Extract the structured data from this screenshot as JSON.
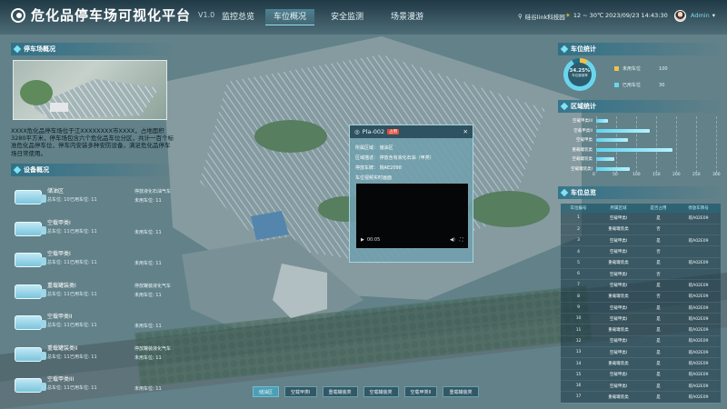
{
  "header": {
    "title": "危化品停车场可视化平台",
    "version": "V1.0",
    "nav": [
      "监控总览",
      "车位概况",
      "安全监测",
      "场景漫游"
    ],
    "active_nav": 1,
    "location": "硅谷link科技园",
    "weather": "12 ~ 30℃",
    "datetime": "2023/09/23 14:43:30",
    "user": "Admin"
  },
  "left": {
    "overview_title": "停车场概况",
    "overview_text": "XXXX危化品停车场位于江XXXXXXXX市XXXX，占地面积3280平方米，停车场包含六个危化品车位分区，共计一百个标准危化品停车位，停车内安装多种安防设备，满足危化品停车场日常使用。",
    "devices_title": "设备概况",
    "devices": [
      {
        "name": "储油区",
        "total": "总车位: 10",
        "used": "已用车位: 11",
        "right": [
          "停放液化石油气车",
          "未用车位: 11"
        ]
      },
      {
        "name": "空载甲类I",
        "total": "总车位: 11",
        "used": "已用车位: 11",
        "right": [
          "",
          "未用车位: 11"
        ]
      },
      {
        "name": "空载甲类I",
        "total": "总车位: 11",
        "used": "已用车位: 11",
        "right": [
          "",
          "未用车位: 11"
        ]
      },
      {
        "name": "重载罐装类I",
        "total": "总车位: 11",
        "used": "已用车位: 11",
        "right": [
          "停放罐装液化气车",
          "未用车位: 11"
        ]
      },
      {
        "name": "空载甲类II",
        "total": "总车位: 11",
        "used": "已用车位: 11",
        "right": [
          "",
          "未用车位: 11"
        ]
      },
      {
        "name": "重载罐装类II",
        "total": "总车位: 11",
        "used": "已用车位: 11",
        "right": [
          "停放罐装液化气车",
          "未用车位: 11"
        ]
      },
      {
        "name": "空载甲类III",
        "total": "总车位: 11",
        "used": "已用车位: 11",
        "right": [
          "",
          "未用车位: 11"
        ]
      }
    ]
  },
  "right": {
    "stats_title": "车位统计",
    "donut_value": "34.25%",
    "donut_caption": "车位使用率",
    "legend": [
      {
        "label": "未用车位",
        "value": "100",
        "color": "#f0c24a"
      },
      {
        "label": "已用车位",
        "value": "30",
        "color": "#6ad6ee"
      }
    ],
    "region_title": "区域统计",
    "regions": [
      {
        "label": "空载甲类III",
        "value": 30
      },
      {
        "label": "空载甲类II",
        "value": 135
      },
      {
        "label": "空载甲类",
        "value": 80
      },
      {
        "label": "重载罐装类",
        "value": 190
      },
      {
        "label": "空载罐装类",
        "value": 45
      },
      {
        "label": "空载罐装类I",
        "value": 85
      }
    ],
    "axis_ticks": [
      "0",
      "50",
      "100",
      "150",
      "200",
      "250",
      "300"
    ],
    "axis_max": 300,
    "list_title": "车位总览",
    "list_headers": [
      "车位编号",
      "所属区域",
      "是否占用",
      "停放车牌号"
    ],
    "rows": [
      [
        "1",
        "空载甲类I",
        "是",
        "皖A02E09"
      ],
      [
        "2",
        "重载罐装类",
        "否",
        ""
      ],
      [
        "3",
        "空载甲类I",
        "是",
        "皖A02E09"
      ],
      [
        "4",
        "空载甲类I",
        "否",
        ""
      ],
      [
        "5",
        "重载罐装类",
        "是",
        "皖A02E09"
      ],
      [
        "6",
        "空载甲类I",
        "否",
        ""
      ],
      [
        "7",
        "空载甲类I",
        "是",
        "皖A02E09"
      ],
      [
        "8",
        "重载罐装类",
        "否",
        "皖A02E09"
      ],
      [
        "9",
        "空载甲类I",
        "是",
        "皖A02E09"
      ],
      [
        "10",
        "空载甲类I",
        "是",
        "皖A02E09"
      ],
      [
        "11",
        "重载罐装类",
        "是",
        "皖A02E09"
      ],
      [
        "12",
        "空载甲类I",
        "是",
        "皖A02E09"
      ],
      [
        "13",
        "空载甲类I",
        "是",
        "皖A02E09"
      ],
      [
        "14",
        "重载罐装类",
        "是",
        "皖A02E09"
      ],
      [
        "15",
        "空载甲类I",
        "是",
        "皖A02E09"
      ],
      [
        "16",
        "空载甲类I",
        "是",
        "皖A02E09"
      ],
      [
        "17",
        "重载罐装类",
        "是",
        "皖A02E09"
      ]
    ]
  },
  "popup": {
    "title": "Pla-002",
    "tag": "占用",
    "rows": [
      "所属区域： 储油区",
      "区域描述： 停放含有液化石油（甲类）",
      "停放车牌： 皖AE2098",
      "车位视频实时画面"
    ],
    "video_time": "00:05"
  },
  "bottom_tabs": [
    "储油区",
    "空载甲类I",
    "重载罐装类",
    "空载罐装类",
    "空载甲类II",
    "重载罐装类"
  ],
  "bottom_active": 0
}
